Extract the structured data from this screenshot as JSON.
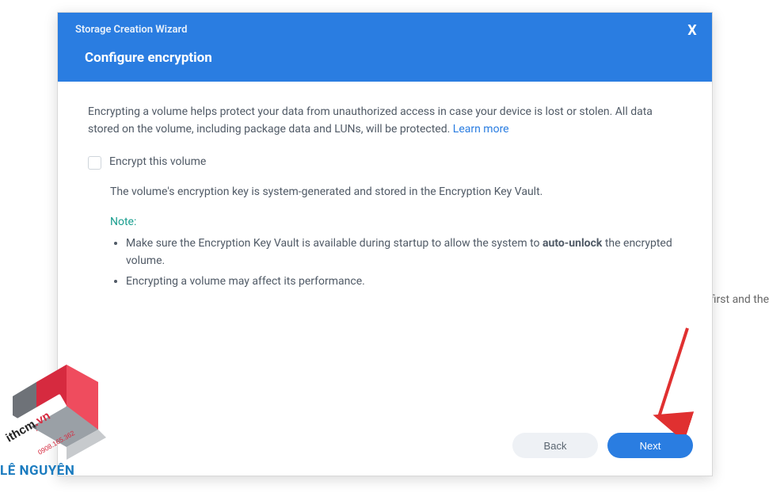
{
  "backgroundSnippet": "first and the",
  "header": {
    "title": "Storage Creation Wizard",
    "subtitle": "Configure encryption",
    "closeGlyph": "X"
  },
  "body": {
    "intro": "Encrypting a volume helps protect your data from unauthorized access in case your device is lost or stolen. All data stored on the volume, including package data and LUNs, will be protected. ",
    "learnMore": "Learn more",
    "checkboxLabel": "Encrypt this volume",
    "keyDesc": "The volume's encryption key is system-generated and stored in the Encryption Key Vault.",
    "note": {
      "label": "Note:",
      "items": [
        {
          "pre": "Make sure the Encryption Key Vault is available during startup to allow the system to ",
          "bold": "auto-unlock",
          "post": " the encrypted volume."
        },
        {
          "pre": "Encrypting a volume may affect its performance.",
          "bold": "",
          "post": ""
        }
      ]
    }
  },
  "footer": {
    "backLabel": "Back",
    "nextLabel": "Next"
  },
  "watermark": {
    "brand": "LÊ NGUYÊN",
    "domain": "ithcm",
    "tld": ".vn",
    "phone": "0908.165.362"
  }
}
